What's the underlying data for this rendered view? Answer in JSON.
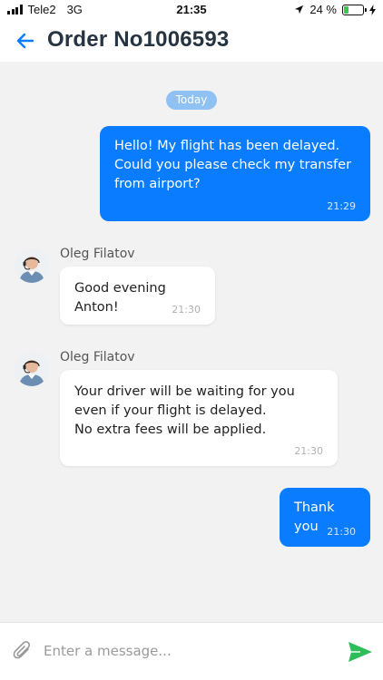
{
  "status_bar": {
    "carrier": "Tele2",
    "network": "3G",
    "time": "21:35",
    "battery_percent": "24 %",
    "battery_level": 0.24
  },
  "header": {
    "title": "Order No1006593",
    "back_icon": "arrow-left-icon"
  },
  "chat": {
    "date_label": "Today",
    "messages": [
      {
        "direction": "outgoing",
        "text": "Hello! My flight has been delayed. Could you please check my transfer from airport?",
        "time": "21:29"
      },
      {
        "direction": "incoming",
        "sender": "Oleg Filatov",
        "text": "Good evening Anton!",
        "time": "21:30"
      },
      {
        "direction": "incoming",
        "sender": "Oleg Filatov",
        "text": "Your driver will be waiting for you even if your flight is delayed.\nNo extra fees will be applied.",
        "time": "21:30"
      },
      {
        "direction": "outgoing",
        "text": "Thank you",
        "time": "21:30"
      }
    ]
  },
  "input_bar": {
    "placeholder": "Enter a message...",
    "value": "",
    "attach_icon": "paperclip-icon",
    "send_icon": "send-icon"
  },
  "colors": {
    "accent": "#0a7cff",
    "send_button": "#2dbd5a",
    "date_pill": "#8fc1f2",
    "title_text": "#263340"
  }
}
